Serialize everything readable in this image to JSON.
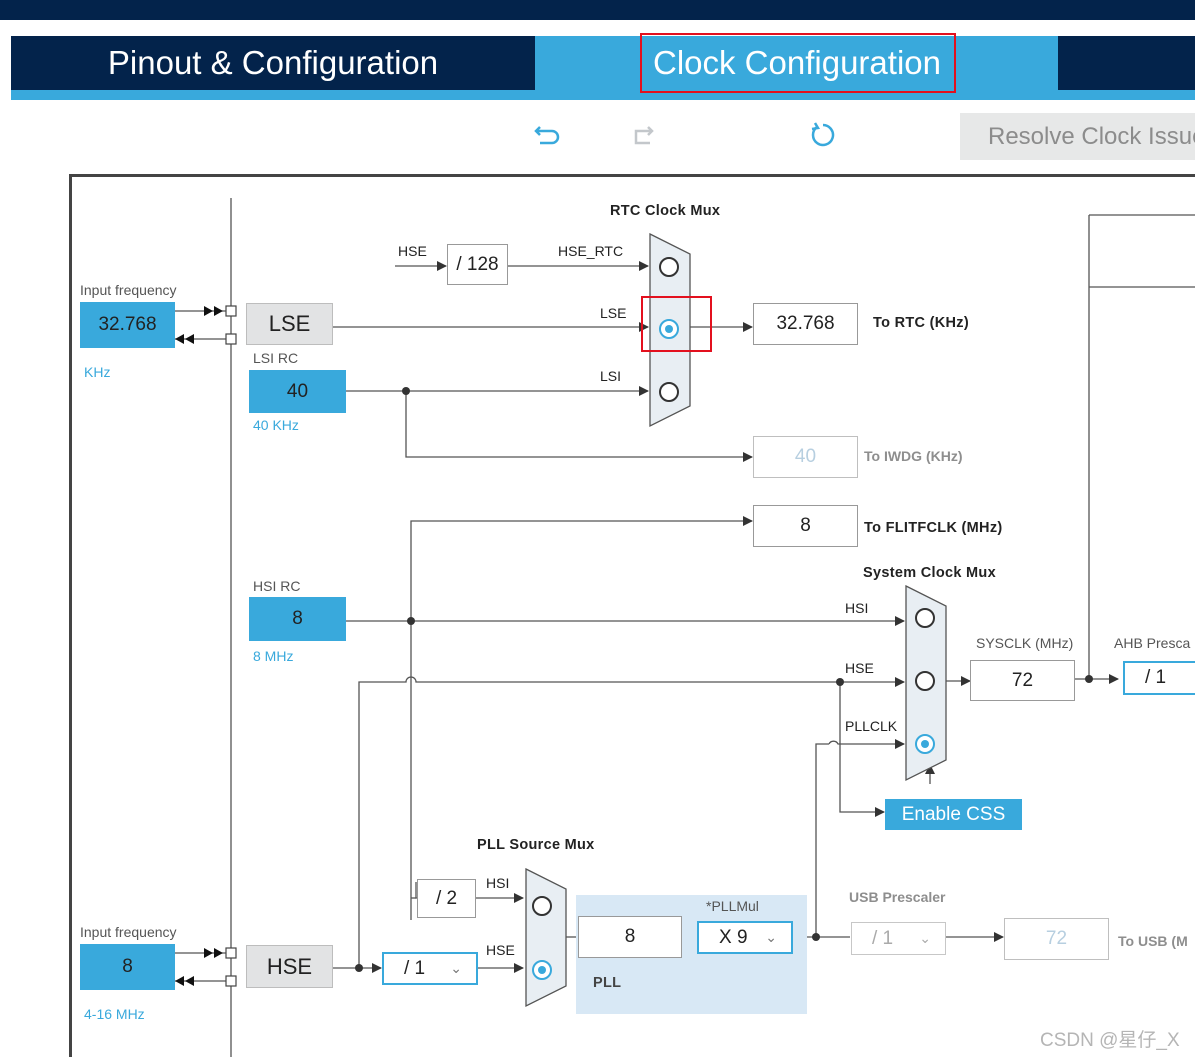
{
  "tabs": {
    "pinout": "Pinout & Configuration",
    "clock": "Clock Configuration"
  },
  "toolbar": {
    "resolve": "Resolve Clock Issues"
  },
  "lse": {
    "in_freq_label": "Input frequency",
    "in_value": "32.768",
    "unit": "KHz",
    "source_label": "LSE"
  },
  "lsi": {
    "title": "LSI RC",
    "value": "40",
    "unit": "40 KHz"
  },
  "hsi": {
    "title": "HSI RC",
    "value": "8",
    "unit": "8 MHz"
  },
  "hse": {
    "in_freq_label": "Input frequency",
    "in_value": "8",
    "unit": "4-16 MHz",
    "source_label": "HSE"
  },
  "rtc_mux": {
    "title": "RTC Clock Mux",
    "hse_label": "HSE",
    "div128": "/ 128",
    "hse_rtc_label": "HSE_RTC",
    "lse_label": "LSE",
    "lsi_label": "LSI",
    "output": "32.768",
    "output_label": "To RTC (KHz)"
  },
  "iwdg": {
    "value": "40",
    "label": "To IWDG (KHz)"
  },
  "flitf": {
    "value": "8",
    "label": "To FLITFCLK (MHz)"
  },
  "sys_mux": {
    "title": "System Clock Mux",
    "hsi_label": "HSI",
    "hse_label": "HSE",
    "pllclk_label": "PLLCLK",
    "sysclk_label": "SYSCLK (MHz)",
    "sysclk": "72",
    "css": "Enable CSS"
  },
  "ahb": {
    "label": "AHB Presca",
    "value": "/ 1"
  },
  "pll_mux": {
    "title": "PLL Source Mux",
    "div2": "/ 2",
    "hsi_label": "HSI",
    "hse_label": "HSE",
    "hse_prediv": "/ 1"
  },
  "pll": {
    "label": "PLL",
    "input": "8",
    "mul_label": "*PLLMul",
    "mul": "X 9"
  },
  "usb": {
    "label": "USB Prescaler",
    "value": "/ 1",
    "output": "72",
    "output_label": "To USB (M"
  },
  "watermark": "CSDN @星仔_X",
  "icons": [
    "undo-icon",
    "redo-icon",
    "refresh-icon",
    "chevron-down-icon"
  ]
}
